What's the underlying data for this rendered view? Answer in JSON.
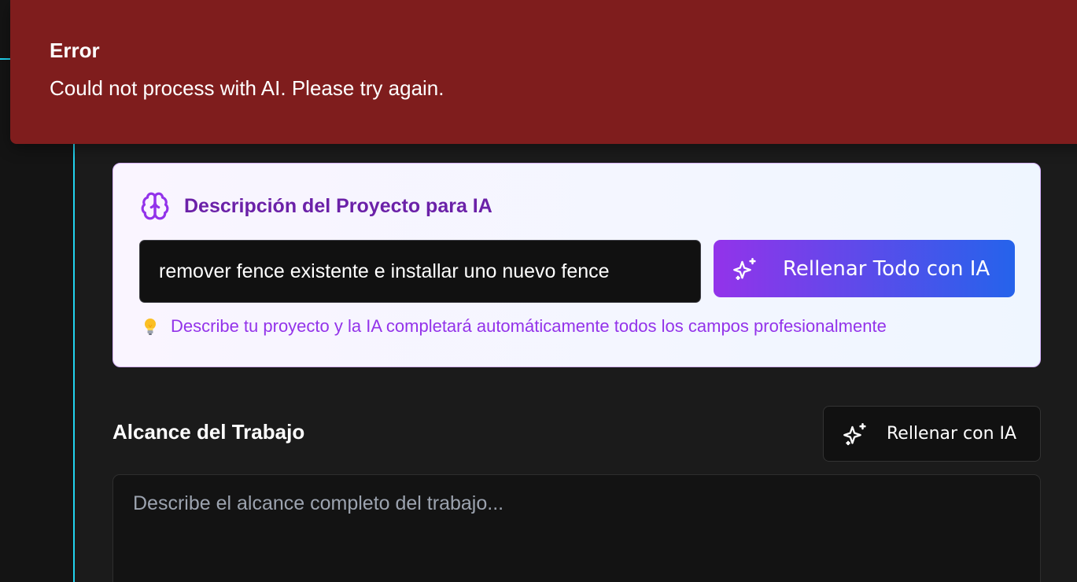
{
  "toast": {
    "title": "Error",
    "message": "Could not process with AI. Please try again.",
    "background_color": "#7f1d1d"
  },
  "ai_card": {
    "title": "Descripción del Proyecto para IA",
    "title_icon": "brain-icon",
    "input_value": "remover fence existente e installar uno nuevo fence",
    "fill_all_button_label": "Rellenar Todo con IA",
    "fill_all_button_icon": "sparkle-icon",
    "hint_icon": "lightbulb-icon",
    "hint_text": "Describe tu proyecto y la IA completará automáticamente todos los campos profesionalmente",
    "accent_color": "#6b21a8",
    "gradient_start": "#9333ea",
    "gradient_end": "#2563eb"
  },
  "scope": {
    "title": "Alcance del Trabajo",
    "fill_button_label": "Rellenar con IA",
    "fill_button_icon": "sparkle-icon",
    "textarea_placeholder": "Describe el alcance completo del trabajo...",
    "textarea_value": ""
  },
  "theme": {
    "background": "#1b1b1b",
    "sidebar_accent": "#22d3ee"
  }
}
